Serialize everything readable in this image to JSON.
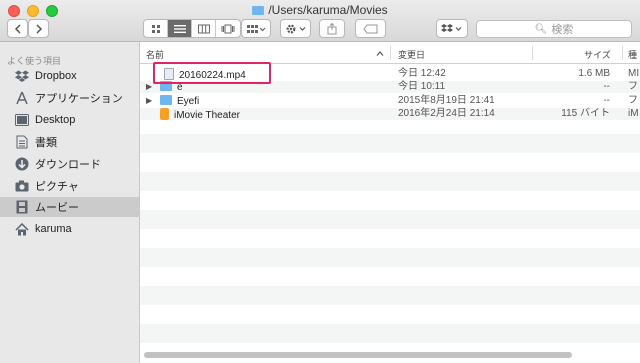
{
  "window": {
    "title": "/Users/karuma/Movies"
  },
  "toolbar": {
    "back_icon": "chevron-left",
    "forward_icon": "chevron-right",
    "view_modes": [
      "icon-view",
      "list-view",
      "column-view",
      "cover-flow-view"
    ],
    "active_view": "list-view",
    "search_placeholder": "検索"
  },
  "sidebar": {
    "heading": "よく使う項目",
    "items": [
      {
        "label": "Dropbox",
        "icon": "dropbox-icon"
      },
      {
        "label": "アプリケーション",
        "icon": "applications-icon"
      },
      {
        "label": "Desktop",
        "icon": "desktop-icon"
      },
      {
        "label": "書類",
        "icon": "documents-icon"
      },
      {
        "label": "ダウンロード",
        "icon": "download-icon"
      },
      {
        "label": "ピクチャ",
        "icon": "camera-icon"
      },
      {
        "label": "ムービー",
        "icon": "film-icon",
        "selected": true
      },
      {
        "label": "karuma",
        "icon": "home-icon"
      }
    ]
  },
  "columns": {
    "name": "名前",
    "modified": "変更日",
    "size": "サイズ",
    "kind": "種"
  },
  "files": [
    {
      "name": "20160224.mp4",
      "modified": "今日 12:42",
      "size": "1.6 MB",
      "kind": "MI",
      "type": "video"
    },
    {
      "name": "e",
      "modified": "今日 10:11",
      "size": "--",
      "kind": "フ",
      "type": "folder"
    },
    {
      "name": "Eyefi",
      "modified": "2015年8月19日 21:41",
      "size": "--",
      "kind": "フ",
      "type": "folder"
    },
    {
      "name": "iMovie Theater",
      "modified": "2016年2月24日 21:14",
      "size": "115 バイト",
      "kind": "iM",
      "type": "imovie"
    }
  ],
  "colors": {
    "highlight": "#e0246a",
    "folder": "#6fb5f0",
    "sidebar_selected": "#cbcbcb"
  }
}
